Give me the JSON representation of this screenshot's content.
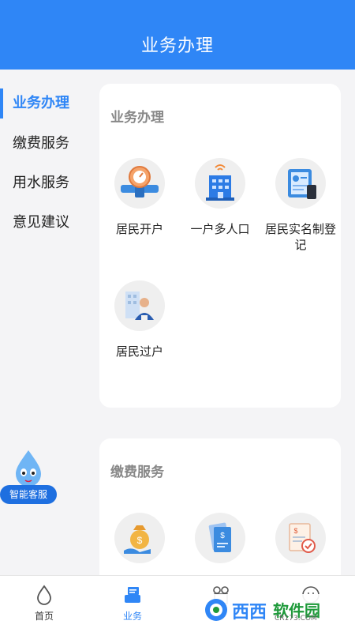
{
  "header": {
    "title": "业务办理"
  },
  "sidebar": {
    "items": [
      {
        "label": "业务办理",
        "active": true
      },
      {
        "label": "缴费服务",
        "active": false
      },
      {
        "label": "用水服务",
        "active": false
      },
      {
        "label": "意见建议",
        "active": false
      }
    ]
  },
  "sections": [
    {
      "title": "业务办理",
      "services": [
        {
          "label": "居民开户",
          "icon": "water-meter-icon"
        },
        {
          "label": "一户多人口",
          "icon": "building-icon"
        },
        {
          "label": "居民实名制登记",
          "icon": "id-registration-icon"
        },
        {
          "label": "居民过户",
          "icon": "person-transfer-icon"
        }
      ]
    },
    {
      "title": "缴费服务",
      "services": [
        {
          "icon": "money-bag-icon"
        },
        {
          "icon": "bill-document-icon"
        },
        {
          "icon": "invoice-check-icon"
        }
      ]
    }
  ],
  "assistant": {
    "label": "智能客服",
    "icon": "water-drop-mascot-icon"
  },
  "bottom_nav": [
    {
      "label": "首页",
      "icon": "water-drop-icon",
      "active": false
    },
    {
      "label": "业务",
      "icon": "tray-icon",
      "active": true
    },
    {
      "label": "",
      "icon": "gift-icon",
      "active": false
    },
    {
      "label": "",
      "icon": "user-icon",
      "active": false
    }
  ],
  "watermark": {
    "brand": "西西",
    "text": "软件园",
    "url": "CR173.COM"
  },
  "colors": {
    "primary": "#2f86f6",
    "background": "#f4f4f6"
  }
}
